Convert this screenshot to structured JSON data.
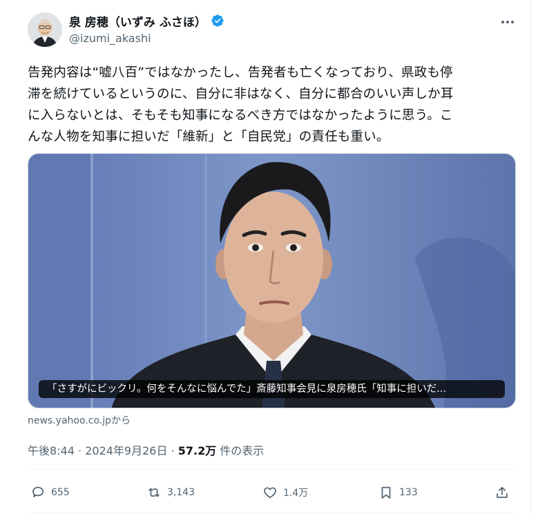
{
  "author": {
    "display_name": "泉 房穂（いずみ ふさほ）",
    "handle": "@izumi_akashi"
  },
  "tweet": {
    "text": "告発内容は“嘘八百”ではなかったし、告発者も亡くなっており、県政も停\n滞を続けているというのに、自分に非はなく、自分に都合のいい声しか耳\nに入らないとは、そもそも知事になるべき方ではなかったように思う。こ\nんな人物を知事に担いだ「維新」と「自民党」の責任も重い。"
  },
  "media": {
    "caption": "「さすがにビックリ。何をそんなに悩んでた」斎藤知事会見に泉房穂氏「知事に担いだ...",
    "source": "news.yahoo.co.jpから"
  },
  "meta": {
    "time": "午後8:44",
    "separator": " · ",
    "date": "2024年9月26日",
    "views_number": "57.2万",
    "views_label": " 件の表示"
  },
  "actions": {
    "replies": "655",
    "reposts": "3,143",
    "likes": "1.4万",
    "bookmarks": "133"
  },
  "colors": {
    "verified": "#1d9bf0",
    "secondary_text": "#536471",
    "primary_text": "#0f1419"
  },
  "icons": [
    "verified-badge-icon",
    "more-options-icon",
    "reply-icon",
    "repost-icon",
    "like-icon",
    "bookmark-icon",
    "share-icon"
  ]
}
